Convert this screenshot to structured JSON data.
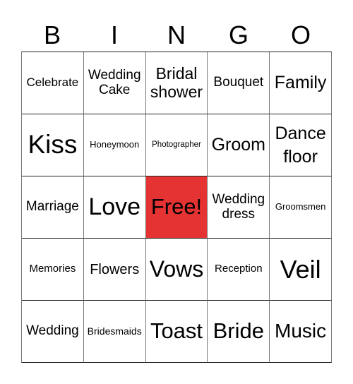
{
  "header": [
    "B",
    "I",
    "N",
    "G",
    "O"
  ],
  "free_color": "#e53333",
  "grid": [
    [
      "Celebrate",
      "Wedding Cake",
      "Bridal shower",
      "Bouquet",
      "Family"
    ],
    [
      "Kiss",
      "Honeymoon",
      "Photographer",
      "Groom",
      "Dance floor"
    ],
    [
      "Marriage",
      "Love",
      "Free!",
      "Wedding dress",
      "Groomsmen"
    ],
    [
      "Memories",
      "Flowers",
      "Vows",
      "Reception",
      "Veil"
    ],
    [
      "Wedding",
      "Bridesmaids",
      "Toast",
      "Bride",
      "Music"
    ]
  ]
}
